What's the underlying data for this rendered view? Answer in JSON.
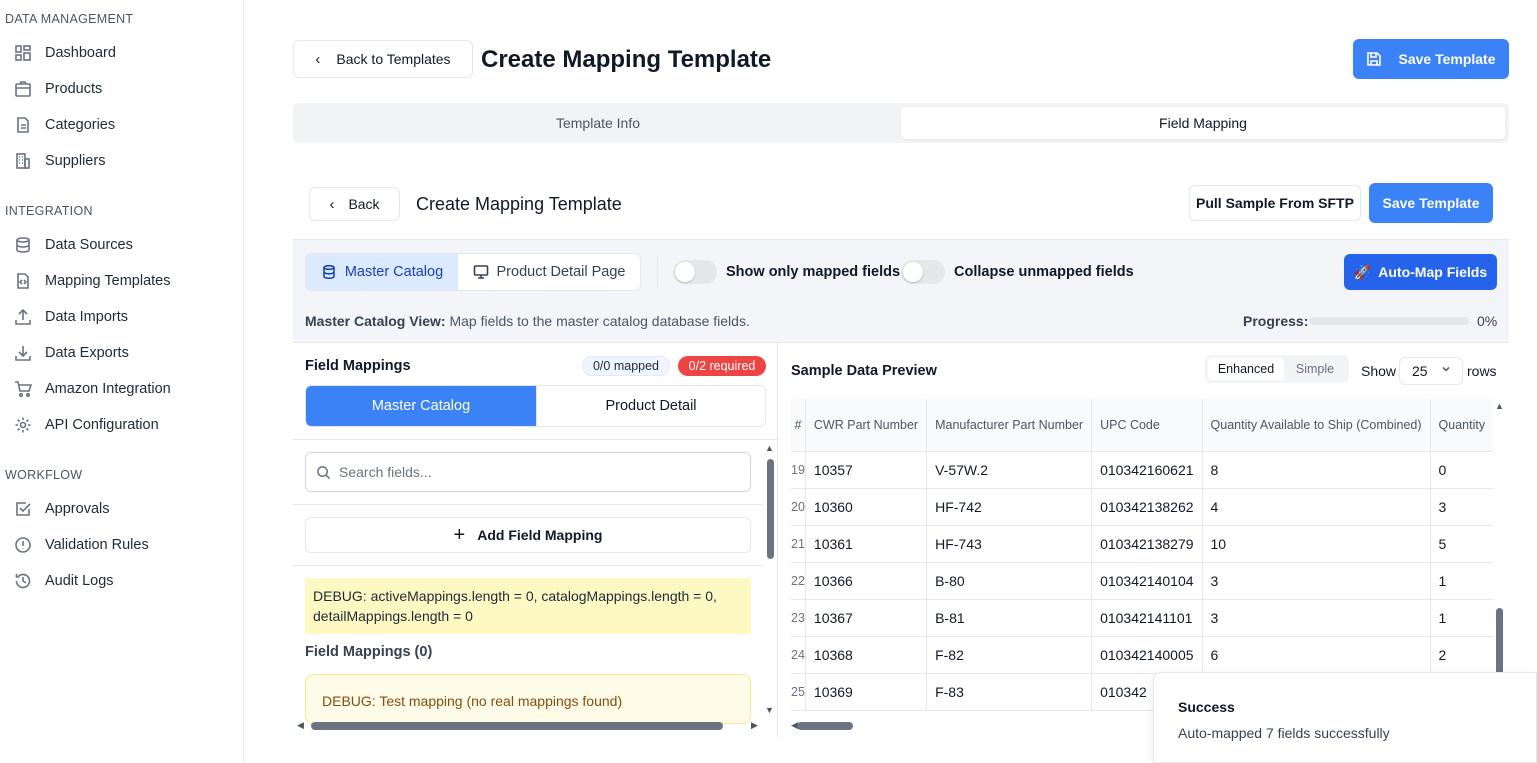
{
  "sidebar": {
    "sections": [
      {
        "title": "DATA MANAGEMENT",
        "items": [
          {
            "label": "Dashboard",
            "icon": "grid-icon"
          },
          {
            "label": "Products",
            "icon": "box-icon"
          },
          {
            "label": "Categories",
            "icon": "file-icon"
          },
          {
            "label": "Suppliers",
            "icon": "building-icon"
          }
        ]
      },
      {
        "title": "INTEGRATION",
        "items": [
          {
            "label": "Data Sources",
            "icon": "database-icon"
          },
          {
            "label": "Mapping Templates",
            "icon": "code-file-icon"
          },
          {
            "label": "Data Imports",
            "icon": "upload-icon"
          },
          {
            "label": "Data Exports",
            "icon": "download-icon"
          },
          {
            "label": "Amazon Integration",
            "icon": "cart-icon"
          },
          {
            "label": "API Configuration",
            "icon": "gear-icon"
          }
        ]
      },
      {
        "title": "WORKFLOW",
        "items": [
          {
            "label": "Approvals",
            "icon": "check-square-icon"
          },
          {
            "label": "Validation Rules",
            "icon": "alert-circle-icon"
          },
          {
            "label": "Audit Logs",
            "icon": "history-icon"
          }
        ]
      }
    ]
  },
  "header": {
    "back_label": "Back to Templates",
    "title": "Create Mapping Template",
    "save_label": "Save Template"
  },
  "tabs": [
    {
      "label": "Template Info",
      "active": false
    },
    {
      "label": "Field Mapping",
      "active": true
    }
  ],
  "subheader": {
    "back_label": "Back",
    "title": "Create Mapping Template",
    "pull_label": "Pull Sample From SFTP",
    "save_label": "Save Template"
  },
  "toolbar": {
    "view_master": "Master Catalog",
    "view_detail": "Product Detail Page",
    "toggle_mapped": "Show only mapped fields",
    "toggle_collapse": "Collapse unmapped fields",
    "automap_label": "Auto-Map Fields",
    "view_desc_bold": "Master Catalog View:",
    "view_desc": "Map fields to the master catalog database fields.",
    "progress_label": "Progress:",
    "progress_value": "0%",
    "progress_fraction": 0
  },
  "field_mappings": {
    "title": "Field Mappings",
    "mapped_badge": "0/0 mapped",
    "required_badge": "0/2 required",
    "tab_master": "Master Catalog",
    "tab_detail": "Product Detail",
    "search_placeholder": "Search fields...",
    "add_label": "Add Field Mapping",
    "debug_text": "DEBUG: activeMappings.length = 0, catalogMappings.length = 0, detailMappings.length = 0",
    "list_title": "Field Mappings (0)",
    "debug_card": "DEBUG: Test mapping (no real mappings found)"
  },
  "preview": {
    "title": "Sample Data Preview",
    "mode_enhanced": "Enhanced",
    "mode_simple": "Simple",
    "show_label": "Show",
    "rows_value": "25",
    "rows_label": "rows",
    "columns": [
      "#",
      "CWR Part Number",
      "Manufacturer Part Number",
      "UPC Code",
      "Quantity Available to Ship (Combined)",
      "Quantity"
    ],
    "rows": [
      [
        "19",
        "10357",
        "V-57W.2",
        "010342160621",
        "8",
        "0"
      ],
      [
        "20",
        "10360",
        "HF-742",
        "010342138262",
        "4",
        "3"
      ],
      [
        "21",
        "10361",
        "HF-743",
        "010342138279",
        "10",
        "5"
      ],
      [
        "22",
        "10366",
        "B-80",
        "010342140104",
        "3",
        "1"
      ],
      [
        "23",
        "10367",
        "B-81",
        "010342141101",
        "3",
        "1"
      ],
      [
        "24",
        "10368",
        "F-82",
        "010342140005",
        "6",
        "2"
      ],
      [
        "25",
        "10369",
        "F-83",
        "010342",
        "",
        ""
      ]
    ]
  },
  "toast": {
    "title": "Success",
    "message": "Auto-mapped 7 fields successfully"
  },
  "colors": {
    "primary": "#3b82f6",
    "automap": "#2563eb",
    "required_badge": "#ef4444",
    "debug_bg": "#fef9c3"
  }
}
